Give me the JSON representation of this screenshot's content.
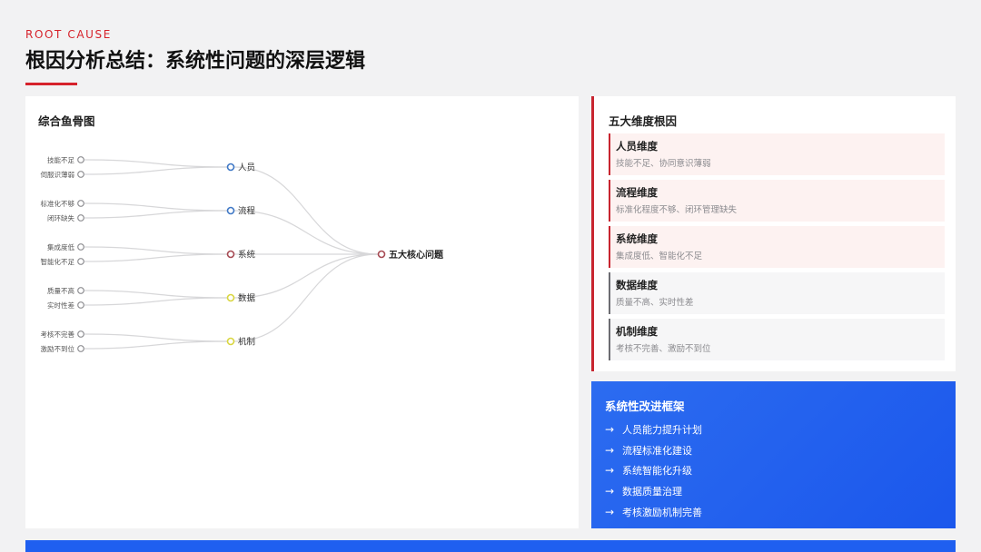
{
  "header": {
    "eyebrow": "ROOT CAUSE",
    "title": "根因分析总结：系统性问题的深层逻辑"
  },
  "fishbone": {
    "heading": "综合鱼骨图",
    "center": "五大核心问题",
    "categories": [
      {
        "label": "人员",
        "color": "#3f78c6",
        "causes": [
          "技能不足",
          "伺服识薄弱"
        ]
      },
      {
        "label": "流程",
        "color": "#3f78c6",
        "causes": [
          "标准化不够",
          "闭环缺失"
        ]
      },
      {
        "label": "系统",
        "color": "#a64a53",
        "causes": [
          "集成度低",
          "智能化不足"
        ]
      },
      {
        "label": "数据",
        "color": "#d9d640",
        "causes": [
          "质量不高",
          "实时性差"
        ]
      },
      {
        "label": "机制",
        "color": "#d9d640",
        "causes": [
          "考核不完善",
          "激励不到位"
        ]
      }
    ]
  },
  "dimensions": {
    "heading": "五大维度根因",
    "items": [
      {
        "name": "人员维度",
        "desc": "技能不足、协同意识薄弱",
        "tone": "red"
      },
      {
        "name": "流程维度",
        "desc": "标准化程度不够、闭环管理缺失",
        "tone": "red"
      },
      {
        "name": "系统维度",
        "desc": "集成度低、智能化不足",
        "tone": "red"
      },
      {
        "name": "数据维度",
        "desc": "质量不高、实时性差",
        "tone": "grey"
      },
      {
        "name": "机制维度",
        "desc": "考核不完善、激励不到位",
        "tone": "grey"
      }
    ]
  },
  "framework": {
    "title": "系统性改进框架",
    "arrow_icon": "arrow-right-icon",
    "items": [
      "人员能力提升计划",
      "流程标准化建设",
      "系统智能化升级",
      "数据质量治理",
      "考核激励机制完善"
    ]
  }
}
